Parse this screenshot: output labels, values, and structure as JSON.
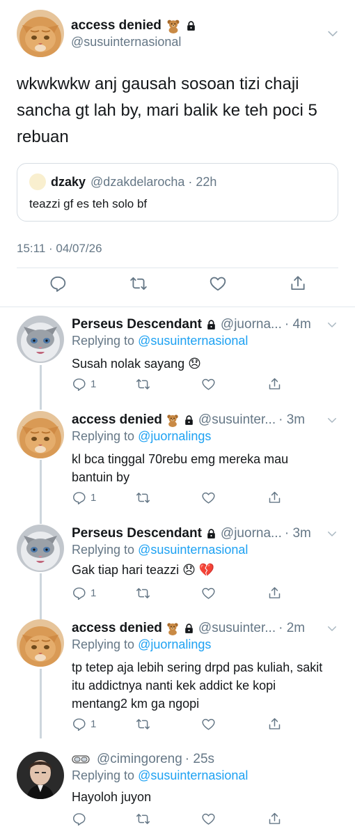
{
  "main_tweet": {
    "display_name": "access denied",
    "name_emoji": "🧸",
    "handle": "@susuinternasional",
    "text": "wkwkwkw anj gausah sosoan tizi chaji sancha gt lah by, mari balik ke teh poci 5 rebuan",
    "quote": {
      "name": "dzaky",
      "handle_time": "@dzakdelarocha · 22h",
      "text": "teazzi gf es teh solo bf"
    },
    "timestamp": "15:11 · 04/07/26"
  },
  "replies": [
    {
      "name": "Perseus Descendant",
      "handle": "@juorna...",
      "time": "· 4m",
      "replying_prefix": "Replying to ",
      "replying_to": "@susuinternasional",
      "text": "Susah nolak sayang 😞",
      "reply_count": "1"
    },
    {
      "name": "access denied",
      "name_emoji": "🧸",
      "handle": "@susuinter...",
      "time": "· 3m",
      "replying_prefix": "Replying to ",
      "replying_to": "@juornalings",
      "text": "kl bca tinggal 70rebu emg mereka mau bantuin by",
      "reply_count": "1"
    },
    {
      "name": "Perseus Descendant",
      "handle": "@juorna...",
      "time": "· 3m",
      "replying_prefix": "Replying to ",
      "replying_to": "@susuinternasional",
      "text": "Gak tiap hari teazzi 😞 💔",
      "reply_count": "1"
    },
    {
      "name": "access denied",
      "name_emoji": "🧸",
      "handle": "@susuinter...",
      "time": "· 2m",
      "replying_prefix": "Replying to ",
      "replying_to": "@juornalings",
      "text": "tp tetep aja lebih sering drpd pas kuliah, sakit itu addictnya nanti kek addict ke kopi mentang2 km ga ngopi",
      "reply_count": "1"
    },
    {
      "name": "",
      "handle": "@cimingoreng",
      "time": "· 25s",
      "replying_prefix": "Replying to ",
      "replying_to": "@susuinternasional",
      "text": "Hayoloh juyon",
      "reply_count": ""
    }
  ],
  "icons": [
    "reply-icon",
    "retweet-icon",
    "like-icon",
    "share-icon",
    "lock-icon",
    "chevron-down-icon",
    "goggles-icon"
  ],
  "colors": {
    "link": "#1da1f2",
    "muted": "#657786",
    "border": "#e1e8ed"
  }
}
